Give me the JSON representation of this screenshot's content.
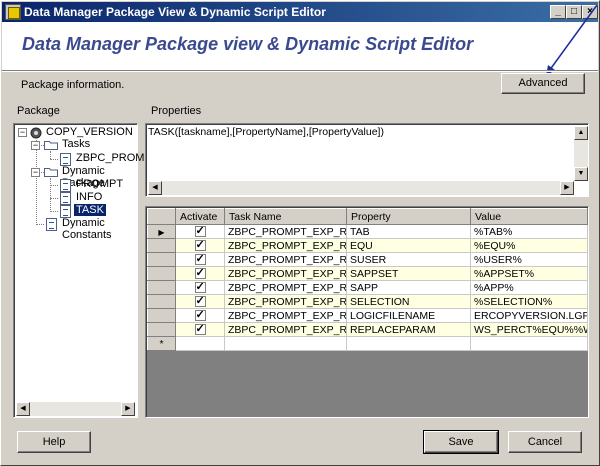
{
  "window": {
    "title": "Data Manager Package View & Dynamic Script Editor",
    "controls": {
      "minimize": "_",
      "maximize": "□",
      "close": "×"
    }
  },
  "header": {
    "title": "Data Manager Package view & Dynamic Script Editor"
  },
  "package_info_label": "Package information.",
  "advanced_button": "Advanced",
  "package_section_label": "Package",
  "properties_section_label": "Properties",
  "tree": {
    "root": "COPY_VERSION",
    "tasks_folder": "Tasks",
    "task_item": "ZBPC_PROMPT",
    "dynamic_folder": "Dynamic Package",
    "dynamic_items": [
      "PROMPT",
      "INFO",
      "TASK"
    ],
    "constants": "Dynamic Constants"
  },
  "properties_text": "TASK([taskname],[PropertyName],[PropertyValue])",
  "grid": {
    "columns": [
      "Activate",
      "Task Name",
      "Property",
      "Value"
    ],
    "rows": [
      {
        "task": "ZBPC_PROMPT_EXP_RUN",
        "property": "TAB",
        "value": "%TAB%"
      },
      {
        "task": "ZBPC_PROMPT_EXP_RUN",
        "property": "EQU",
        "value": "%EQU%"
      },
      {
        "task": "ZBPC_PROMPT_EXP_RUN",
        "property": "SUSER",
        "value": "%USER%"
      },
      {
        "task": "ZBPC_PROMPT_EXP_RUN",
        "property": "SAPPSET",
        "value": "%APPSET%"
      },
      {
        "task": "ZBPC_PROMPT_EXP_RUN",
        "property": "SAPP",
        "value": "%APP%"
      },
      {
        "task": "ZBPC_PROMPT_EXP_RUN",
        "property": "SELECTION",
        "value": "%SELECTION%"
      },
      {
        "task": "ZBPC_PROMPT_EXP_RUN",
        "property": "LOGICFILENAME",
        "value": "ERCOPYVERSION.LGF"
      },
      {
        "task": "ZBPC_PROMPT_EXP_RUN",
        "property": "REPLACEPARAM",
        "value": "WS_PERCT%EQU%%WS_"
      }
    ],
    "new_row_marker": "*"
  },
  "buttons": {
    "help": "Help",
    "save": "Save",
    "cancel": "Cancel"
  }
}
